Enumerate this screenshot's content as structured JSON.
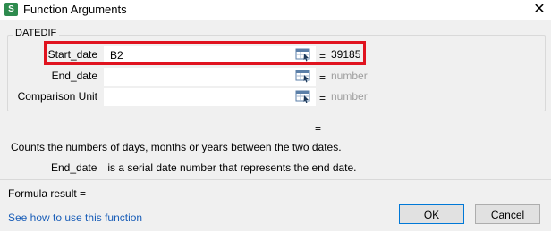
{
  "window": {
    "title": "Function Arguments",
    "app_icon_letter": "S",
    "close_glyph": "✕"
  },
  "function_name": "DATEDIF",
  "arguments": [
    {
      "label": "Start_date",
      "value": "B2",
      "result": "39185"
    },
    {
      "label": "End_date",
      "value": "",
      "result": "number"
    },
    {
      "label": "Comparison Unit",
      "value": "",
      "result": "number"
    }
  ],
  "equals_sign": "=",
  "description": "Counts the numbers of days, months or years between the two dates.",
  "argument_help": {
    "name": "End_date",
    "text": "is a serial date number that represents the end date."
  },
  "formula_result_label": "Formula result  =",
  "help_link": "See how to use this function",
  "buttons": {
    "ok": "OK",
    "cancel": "Cancel"
  },
  "colors": {
    "highlight": "#e0131f",
    "link": "#1a5eb8",
    "muted": "#9e9e9e",
    "app_icon": "#2e8b4e"
  }
}
